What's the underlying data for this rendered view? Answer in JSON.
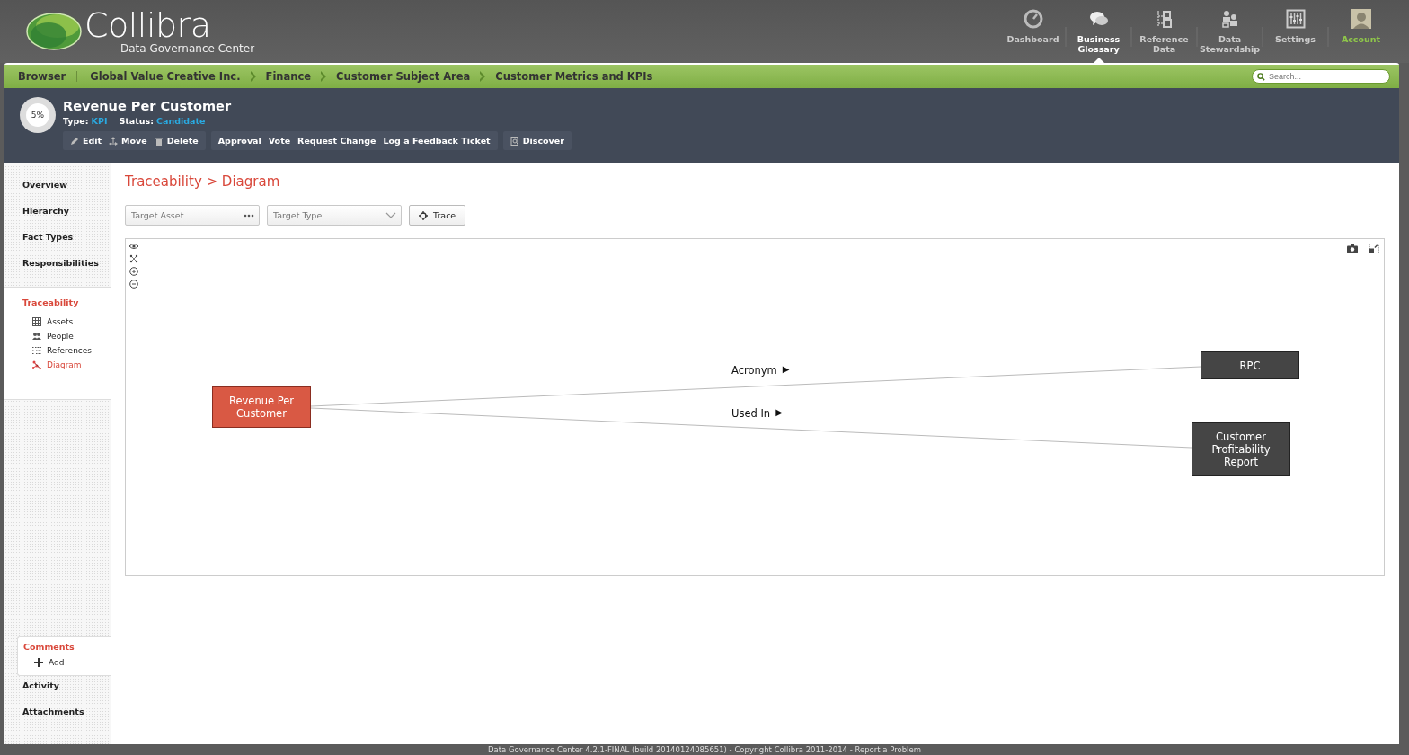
{
  "logo": {
    "name": "Collibra",
    "subtitle": "Data Governance Center"
  },
  "nav": [
    {
      "label": "Dashboard",
      "kind": "gauge",
      "selected": false
    },
    {
      "label": "Business Glossary",
      "kind": "chat",
      "selected": true
    },
    {
      "label": "Reference Data",
      "kind": "reference",
      "selected": false
    },
    {
      "label": "Data Stewardship",
      "kind": "people",
      "selected": false
    },
    {
      "label": "Settings",
      "kind": "sliders",
      "selected": false
    },
    {
      "label": "Account",
      "kind": "avatar",
      "selected": false
    }
  ],
  "browser": {
    "label": "Browser",
    "breadcrumbs": [
      "Global Value Creative Inc.",
      "Finance",
      "Customer Subject Area",
      "Customer Metrics and KPIs"
    ],
    "search": {
      "placeholder": "Search..."
    }
  },
  "asset": {
    "progress": "5%",
    "title": "Revenue Per Customer",
    "type_label": "Type:",
    "type": "KPI",
    "status_label": "Status:",
    "status": "Candidate",
    "action_groups": [
      [
        {
          "label": "Edit",
          "kind": "pencil"
        },
        {
          "label": "Move",
          "kind": "move"
        },
        {
          "label": "Delete",
          "kind": "trash"
        }
      ],
      [
        {
          "label": "Approval",
          "kind": "plain"
        },
        {
          "label": "Vote",
          "kind": "plain"
        },
        {
          "label": "Request Change",
          "kind": "plain"
        },
        {
          "label": "Log a Feedback Ticket",
          "kind": "plain"
        }
      ],
      [
        {
          "label": "Discover",
          "kind": "discover"
        }
      ]
    ]
  },
  "sidebar": {
    "items": [
      {
        "label": "Overview",
        "selected": false
      },
      {
        "label": "Hierarchy",
        "selected": false
      },
      {
        "label": "Fact Types",
        "selected": false
      },
      {
        "label": "Responsibilities",
        "selected": false
      },
      {
        "label": "Traceability",
        "selected": true,
        "children": [
          {
            "label": "Assets",
            "kind": "table",
            "selected": false
          },
          {
            "label": "People",
            "kind": "people",
            "selected": false
          },
          {
            "label": "References",
            "kind": "list",
            "selected": false
          },
          {
            "label": "Diagram",
            "kind": "diagram",
            "selected": true
          }
        ]
      }
    ],
    "comments": {
      "label": "Comments",
      "add": "Add"
    },
    "bottom_items": [
      {
        "label": "Activity",
        "selected": false
      },
      {
        "label": "Attachments",
        "selected": false
      }
    ]
  },
  "page_title": "Traceability > Diagram",
  "filters": {
    "target_asset": {
      "placeholder": "Target Asset"
    },
    "target_type": {
      "placeholder": "Target Type"
    },
    "trace_button": "Trace"
  },
  "diagram": {
    "nodes": [
      {
        "label": "Revenue Per Customer",
        "kind": "source"
      },
      {
        "label": "RPC",
        "kind": "target"
      },
      {
        "label": "Customer Profitability Report",
        "kind": "target"
      }
    ],
    "edges": [
      {
        "label": "Acronym",
        "arrow": "▶"
      },
      {
        "label": "Used In",
        "arrow": "▶"
      }
    ]
  },
  "footer": "Data Governance Center 4.2.1-FINAL (build 20140124085651) - Copyright Collibra 2011-2014 - Report a Problem"
}
